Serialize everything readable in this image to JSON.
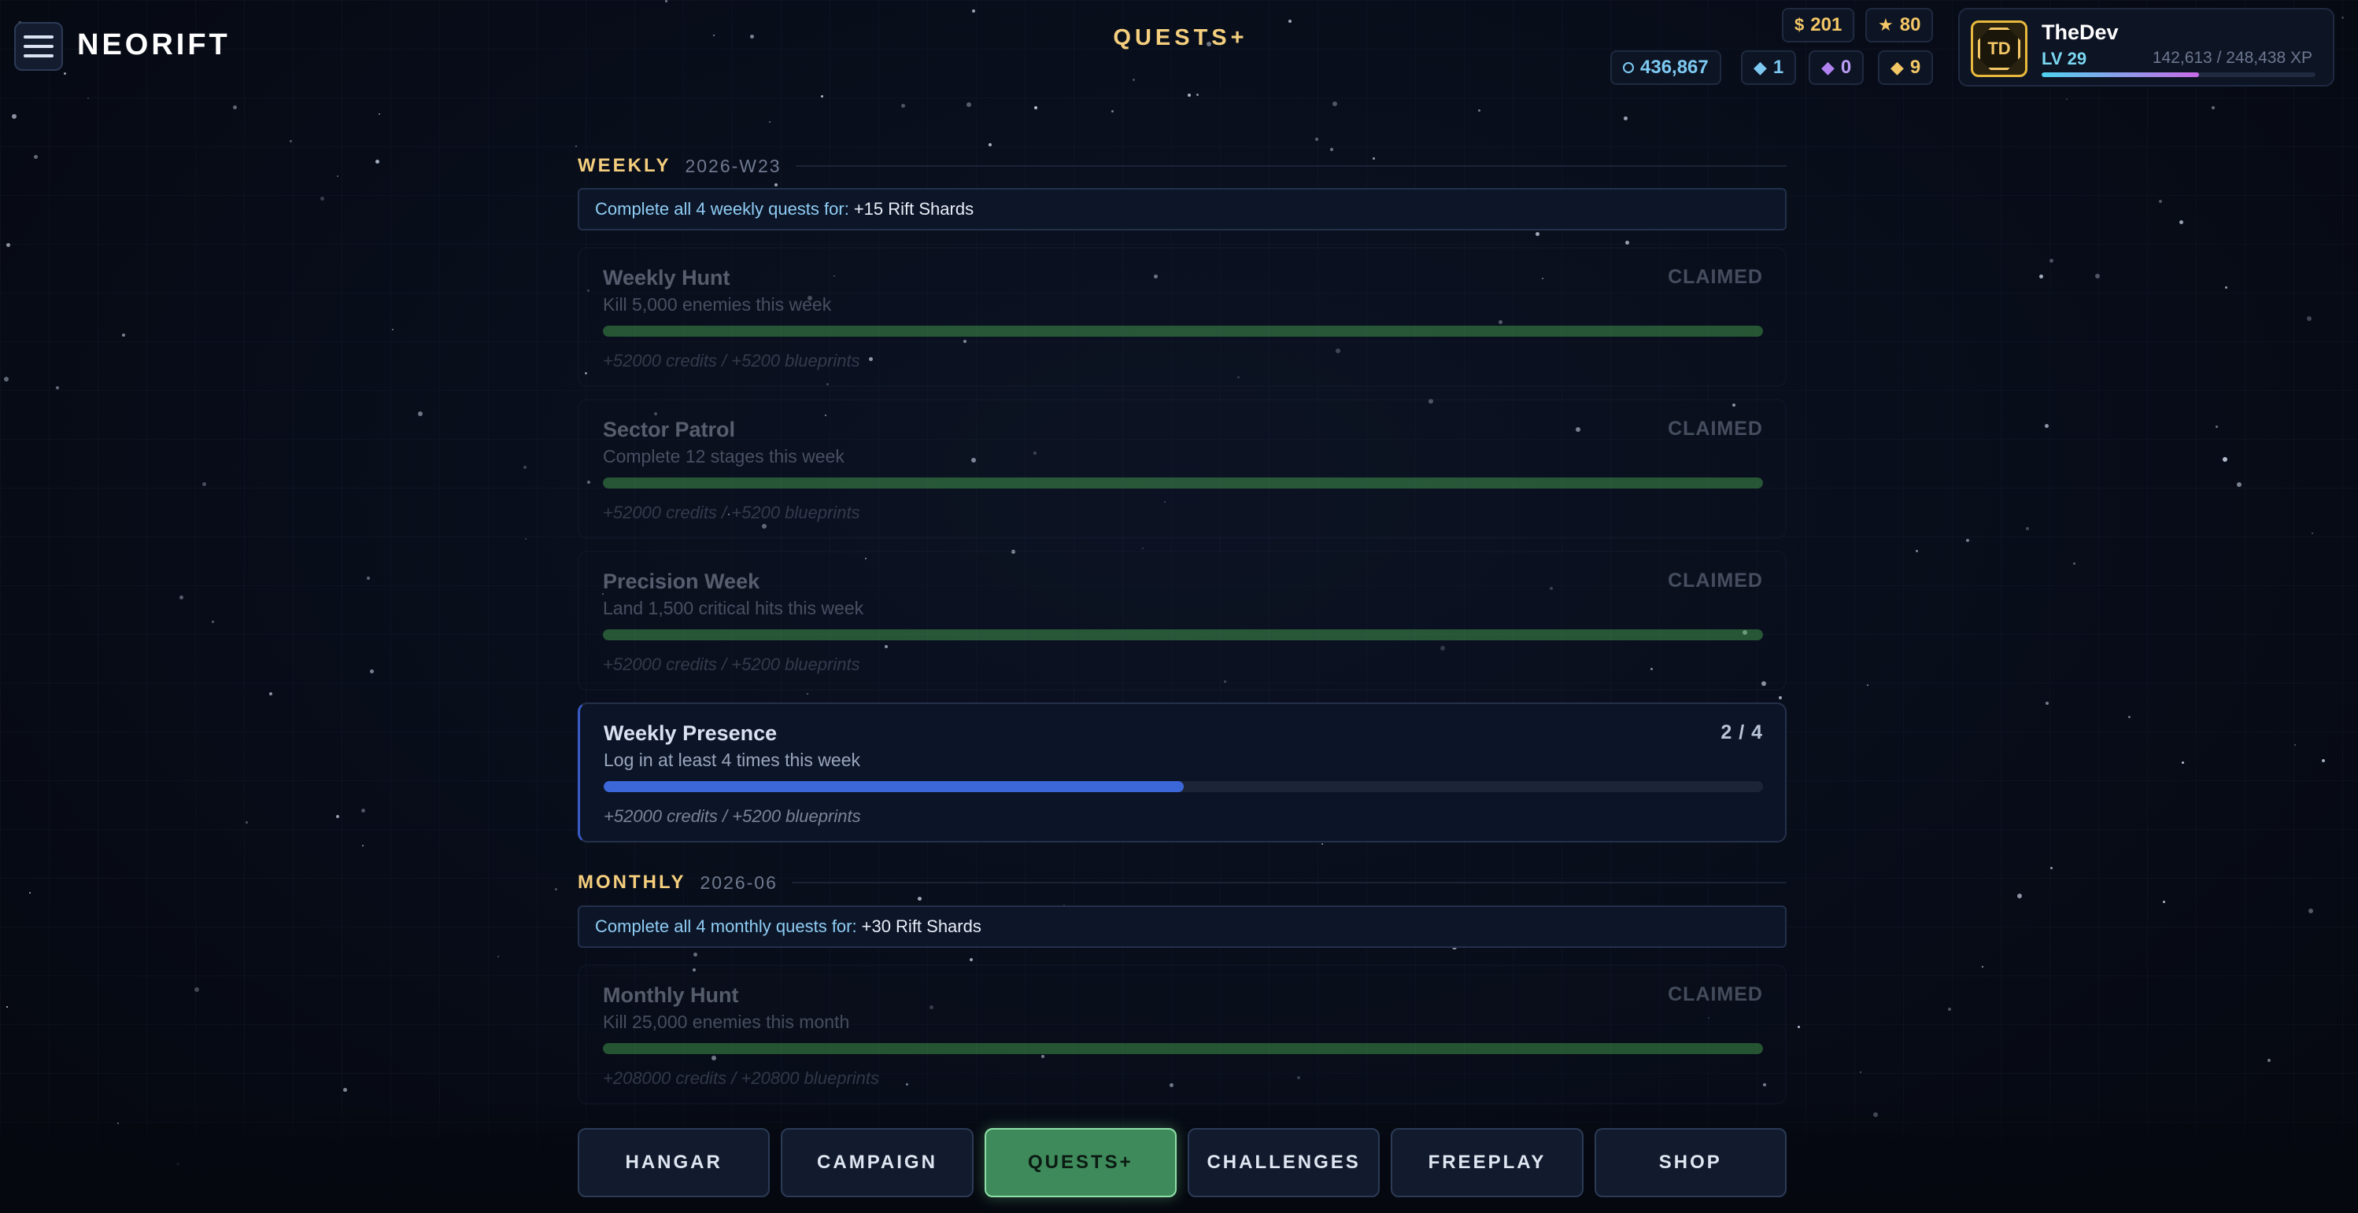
{
  "app": {
    "name": "NEORIFT",
    "page_title": "QUESTS+"
  },
  "currencies": {
    "dollar": {
      "icon": "dollar-icon",
      "glyph": "$",
      "value": "201"
    },
    "star": {
      "icon": "star-icon",
      "glyph": "★",
      "value": "80"
    },
    "coins": {
      "icon": "coin-ring-icon",
      "value": "436,867"
    },
    "blue_gem": {
      "icon": "blue-diamond-icon",
      "glyph": "◆",
      "value": "1"
    },
    "purple_gem": {
      "icon": "purple-diamond-icon",
      "glyph": "◆",
      "value": "0"
    },
    "gold_gem": {
      "icon": "gold-diamond-icon",
      "glyph": "◆",
      "value": "9"
    }
  },
  "profile": {
    "avatar_initials": "TD",
    "name": "TheDev",
    "level": "LV 29",
    "xp_text": "142,613 / 248,438 XP",
    "xp_progress": 0.574
  },
  "weekly": {
    "label": "WEEKLY",
    "period": "2026-W23",
    "bonus_prefix": "Complete all 4 weekly quests for:",
    "bonus_reward": "+15 Rift Shards",
    "quests": [
      {
        "title": "Weekly Hunt",
        "desc": "Kill 5,000 enemies this week",
        "status": "CLAIMED",
        "progress": 1.0,
        "reward": "+52000 credits / +5200 blueprints"
      },
      {
        "title": "Sector Patrol",
        "desc": "Complete 12 stages this week",
        "status": "CLAIMED",
        "progress": 1.0,
        "reward": "+52000 credits / +5200 blueprints"
      },
      {
        "title": "Precision Week",
        "desc": "Land 1,500 critical hits this week",
        "status": "CLAIMED",
        "progress": 1.0,
        "reward": "+52000 credits / +5200 blueprints"
      },
      {
        "title": "Weekly Presence",
        "desc": "Log in at least 4 times this week",
        "status": "2 / 4",
        "progress": 0.5,
        "reward": "+52000 credits / +5200 blueprints"
      }
    ]
  },
  "monthly": {
    "label": "MONTHLY",
    "period": "2026-06",
    "bonus_prefix": "Complete all 4 monthly quests for:",
    "bonus_reward": "+30 Rift Shards",
    "quests": [
      {
        "title": "Monthly Hunt",
        "desc": "Kill 25,000 enemies this month",
        "status": "CLAIMED",
        "progress": 1.0,
        "reward": "+208000 credits / +20800 blueprints"
      }
    ]
  },
  "nav": {
    "items": [
      "HANGAR",
      "CAMPAIGN",
      "QUESTS+",
      "CHALLENGES",
      "FREEPLAY",
      "SHOP"
    ],
    "active_index": 2
  },
  "colors": {
    "accent_gold": "#f5cf7e",
    "progress_done": "#4fb857",
    "progress_active": "#3c67d8",
    "nav_active": "#3e8a5b"
  }
}
